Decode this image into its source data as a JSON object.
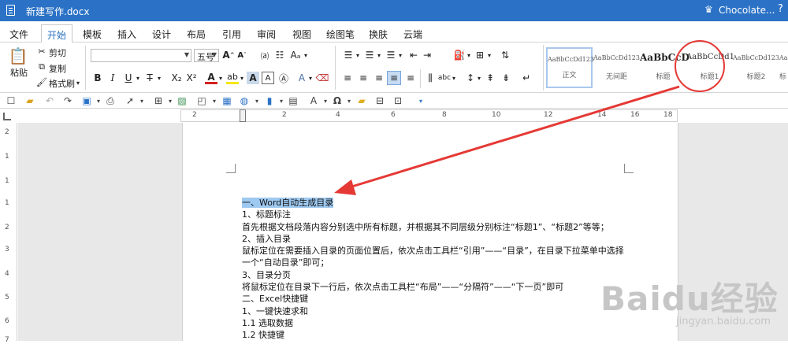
{
  "titlebar": {
    "file_name": "新建写作.docx",
    "user": "Chocolate...",
    "help": "?"
  },
  "tabs": [
    "文件",
    "开始",
    "模板",
    "插入",
    "设计",
    "布局",
    "引用",
    "审阅",
    "视图",
    "绘图笔",
    "换肤",
    "云端"
  ],
  "ribbon": {
    "paste": "粘贴",
    "cut": "剪切",
    "copy": "复制",
    "format_painter": "格式刷",
    "font_size": "五号",
    "style_gallery": [
      {
        "preview": "AaBbCcDd123",
        "name": "正文"
      },
      {
        "preview": "AaBbCcDd123",
        "name": "无间距"
      },
      {
        "preview": "AaBbCcD",
        "name": "标题"
      },
      {
        "preview": "AaBbCcDd1",
        "name": "标题1"
      },
      {
        "preview": "AaBbCcDd123",
        "name": "标题2"
      },
      {
        "preview": "AaBb",
        "name": "标"
      }
    ]
  },
  "ruler_h": [
    "2",
    "2",
    "4",
    "6",
    "8",
    "10",
    "12",
    "14",
    "16",
    "18"
  ],
  "ruler_v": [
    "2",
    "1",
    "1",
    "1",
    "2",
    "3",
    "4",
    "5",
    "6",
    "7"
  ],
  "document": {
    "h1": "一、Word自动生成目录",
    "s1": "1、标题标注",
    "p1": "首先根据文档段落内容分别选中所有标题，并根据其不同层级分别标注“标题1”、“标题2”等等；",
    "s2": "2、插入目录",
    "p2": "鼠标定位在需要插入目录的页面位置后，依次点击工具栏“引用”——“目录”，在目录下拉菜单中选择一个“自动目录”即可；",
    "s3": "3、目录分页",
    "p3": "将鼠标定位在目录下一行后，依次点击工具栏“布局”——“分隔符”——“下一页”即可",
    "h2": "二、Excel快捷键",
    "s4": "1、一键快速求和",
    "s5": "1.1 选取数据",
    "s6": "1.2 快捷键"
  },
  "watermark": {
    "brand": "Baidu经验",
    "url": "jingyan.baidu.com"
  },
  "colors": {
    "titlebar": "#2b72c6",
    "highlight": "#9ec9f0",
    "annotation": "#e53935"
  }
}
